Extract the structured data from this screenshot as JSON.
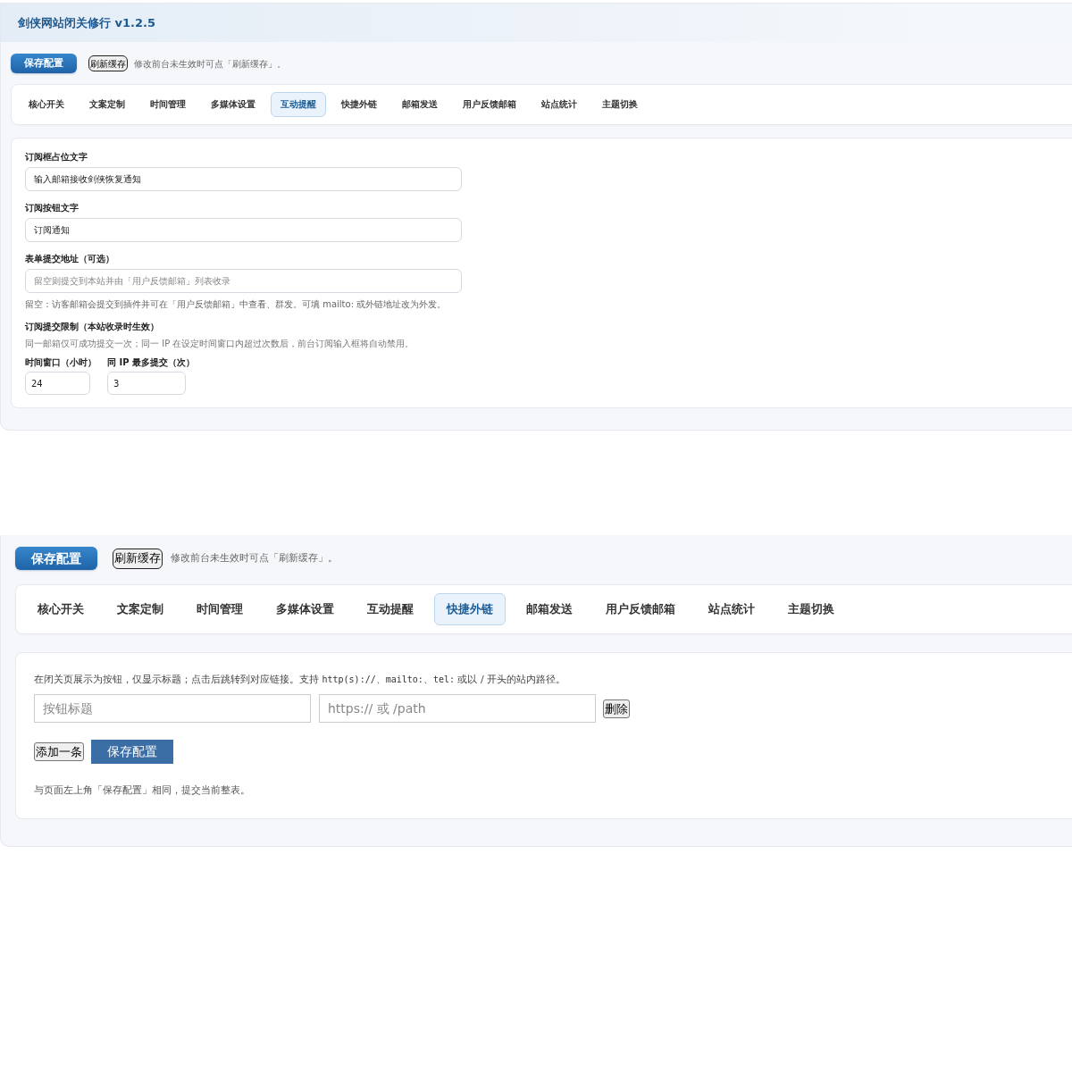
{
  "panels": [
    {
      "title": "剑侠网站闭关修行 v1.2.5",
      "toolbar": {
        "save_button": "保存配置",
        "refresh_button": "刷新缓存",
        "hint": "修改前台未生效时可点「刷新缓存」。"
      },
      "tabs": [
        {
          "label": "核心开关",
          "selected": false
        },
        {
          "label": "文案定制",
          "selected": false
        },
        {
          "label": "时间管理",
          "selected": false
        },
        {
          "label": "多媒体设置",
          "selected": false
        },
        {
          "label": "互动提醒",
          "selected": true
        },
        {
          "label": "快捷外链",
          "selected": false
        },
        {
          "label": "邮箱发送",
          "selected": false
        },
        {
          "label": "用户反馈邮箱",
          "selected": false
        },
        {
          "label": "站点统计",
          "selected": false
        },
        {
          "label": "主题切换",
          "selected": false
        }
      ],
      "content": {
        "kind": "form",
        "fields": [
          {
            "label": "订阅框占位文字",
            "value": "输入邮箱接收剑侠恢复通知"
          },
          {
            "label": "订阅按钮文字",
            "value": "订阅通知"
          },
          {
            "label": "表单提交地址（可选）",
            "placeholder": "留空则提交到本站并由「用户反馈邮箱」列表收录",
            "help": "留空：访客邮箱会提交到插件并可在「用户反馈邮箱」中查看、群发。可填 mailto: 或外链地址改为外发。"
          }
        ],
        "limit_section": {
          "title": "订阅提交限制（本站收录时生效）",
          "description": "同一邮箱仅可成功提交一次；同一 IP 在设定时间窗口内超过次数后，前台订阅输入框将自动禁用。",
          "fields": [
            {
              "label": "时间窗口（小时）",
              "value": "24"
            },
            {
              "label": "同 IP 最多提交（次）",
              "value": "3"
            }
          ]
        }
      }
    },
    {
      "toolbar": {
        "save_button": "保存配置",
        "refresh_button": "刷新缓存",
        "hint": "修改前台未生效时可点「刷新缓存」。"
      },
      "tabs": [
        {
          "label": "核心开关",
          "selected": false
        },
        {
          "label": "文案定制",
          "selected": false
        },
        {
          "label": "时间管理",
          "selected": false
        },
        {
          "label": "多媒体设置",
          "selected": false
        },
        {
          "label": "互动提醒",
          "selected": false
        },
        {
          "label": "快捷外链",
          "selected": true
        },
        {
          "label": "邮箱发送",
          "selected": false
        },
        {
          "label": "用户反馈邮箱",
          "selected": false
        },
        {
          "label": "站点统计",
          "selected": false
        },
        {
          "label": "主题切换",
          "selected": false
        }
      ],
      "content": {
        "kind": "links",
        "description": [
          {
            "kind": "text",
            "text": "在闭关页展示为按钮，仅显示标题；点击后跳转到对应链接。支持 "
          },
          {
            "kind": "code",
            "text": "http(s)://"
          },
          {
            "kind": "text",
            "text": "、"
          },
          {
            "kind": "code",
            "text": "mailto:"
          },
          {
            "kind": "text",
            "text": "、"
          },
          {
            "kind": "code",
            "text": "tel:"
          },
          {
            "kind": "text",
            "text": " 或以 / 开头的站内路径。"
          }
        ],
        "rows": [
          {
            "title_placeholder": "按钮标题",
            "url_placeholder": "https:// 或 /path",
            "delete_button": "删除"
          }
        ],
        "add_button": "添加一条",
        "save_button": "保存配置",
        "note": "与页面左上角「保存配置」相同，提交当前整表。"
      }
    }
  ]
}
